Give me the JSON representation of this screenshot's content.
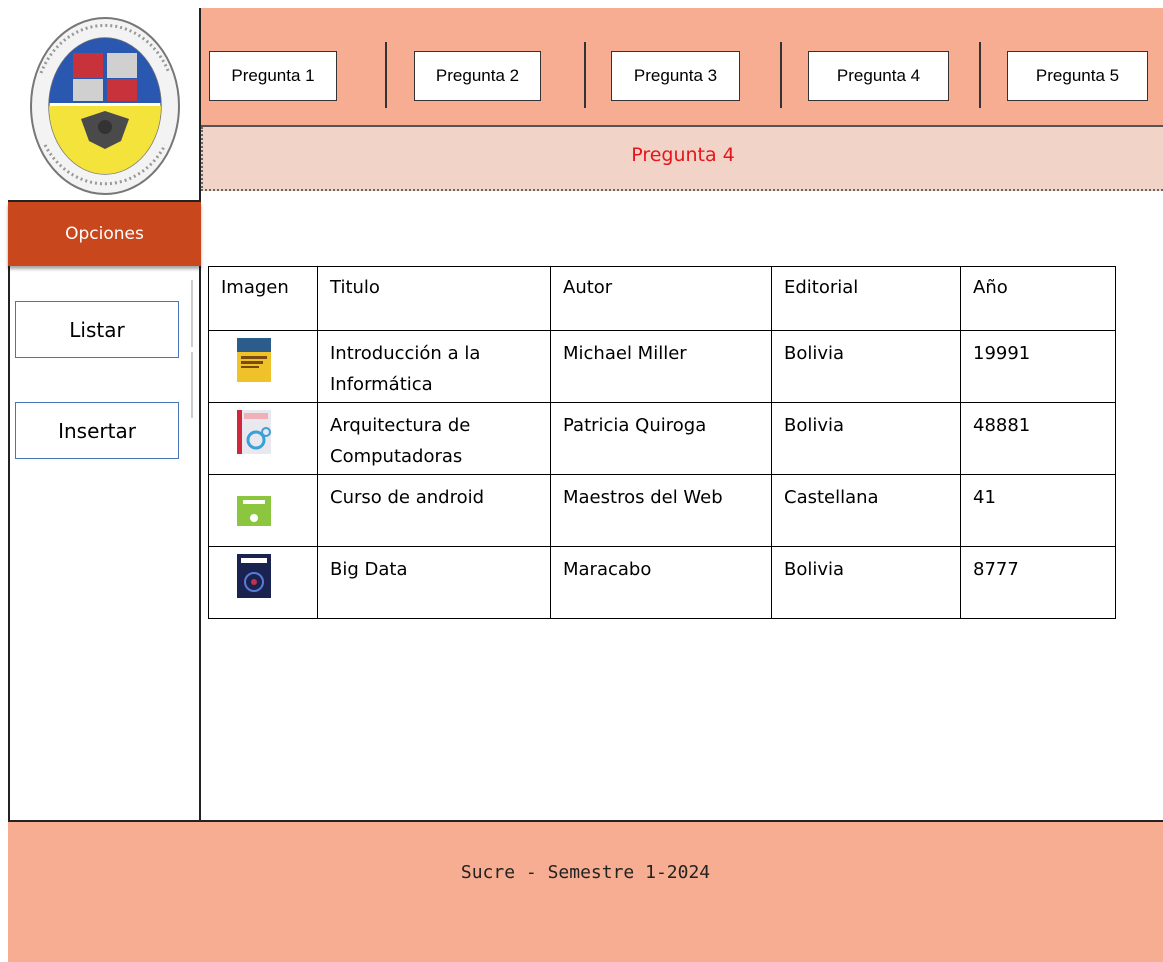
{
  "nav": {
    "buttons": [
      "Pregunta 1",
      "Pregunta 2",
      "Pregunta 3",
      "Pregunta 4",
      "Pregunta 5"
    ]
  },
  "page_title": "Pregunta 4",
  "sidebar": {
    "header": "Opciones",
    "items": [
      "Listar",
      "Insertar"
    ]
  },
  "table": {
    "headers": [
      "Imagen",
      "Titulo",
      "Autor",
      "Editorial",
      "Año"
    ],
    "rows": [
      {
        "titulo": "Introducción a la Informática",
        "autor": "Michael Miller",
        "editorial": "Bolivia",
        "anio": "19991"
      },
      {
        "titulo": "Arquitectura de Computadoras",
        "autor": "Patricia Quiroga",
        "editorial": "Bolivia",
        "anio": "48881"
      },
      {
        "titulo": "Curso de android",
        "autor": "Maestros del Web",
        "editorial": "Castellana",
        "anio": "41"
      },
      {
        "titulo": "Big Data",
        "autor": "Maracabo",
        "editorial": "Bolivia",
        "anio": "8777"
      }
    ]
  },
  "footer": "Sucre - Semestre 1-2024",
  "colors": {
    "nav_bg": "#f7ad91",
    "subheader_bg": "#f2d3c7",
    "title_red": "#e8141b",
    "opciones_bg": "#c9471d",
    "button_border": "#4a74b8"
  }
}
